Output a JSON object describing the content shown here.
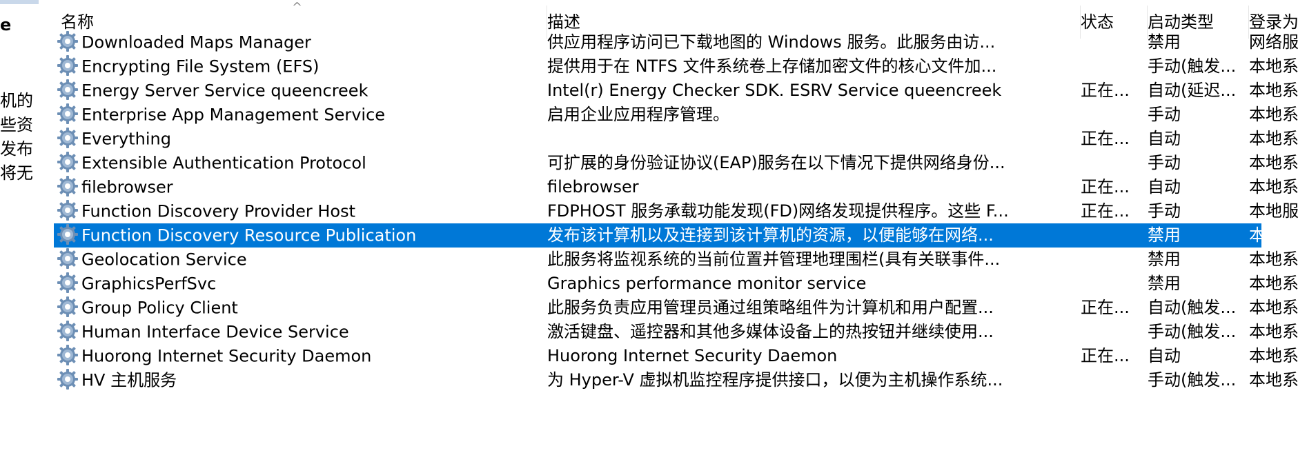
{
  "left_panel": {
    "heading": "e",
    "lines": [
      "机的",
      "些资",
      "发布",
      "将无"
    ]
  },
  "columns": {
    "name": "名称",
    "description": "描述",
    "status": "状态",
    "startup_type": "启动类型",
    "logon_as": "登录为",
    "sort_indicator": "^"
  },
  "rows": [
    {
      "name": "Downloaded Maps Manager",
      "description": "供应用程序访问已下载地图的 Windows 服务。此服务由访...",
      "status": "",
      "startup": "禁用",
      "logon": "网络服务"
    },
    {
      "name": "Encrypting File System (EFS)",
      "description": "提供用于在 NTFS 文件系统卷上存储加密文件的核心文件加...",
      "status": "",
      "startup": "手动(触发...",
      "logon": "本地系统"
    },
    {
      "name": "Energy Server Service queencreek",
      "description": "Intel(r) Energy Checker SDK. ESRV Service queencreek",
      "status": "正在...",
      "startup": "自动(延迟...",
      "logon": "本地系统"
    },
    {
      "name": "Enterprise App Management Service",
      "description": "启用企业应用程序管理。",
      "status": "",
      "startup": "手动",
      "logon": "本地系统"
    },
    {
      "name": "Everything",
      "description": "",
      "status": "正在...",
      "startup": "自动",
      "logon": "本地系统"
    },
    {
      "name": "Extensible Authentication Protocol",
      "description": "可扩展的身份验证协议(EAP)服务在以下情况下提供网络身份...",
      "status": "",
      "startup": "手动",
      "logon": "本地系统"
    },
    {
      "name": "filebrowser",
      "description": "filebrowser",
      "status": "正在...",
      "startup": "自动",
      "logon": "本地系统"
    },
    {
      "name": "Function Discovery Provider Host",
      "description": "FDPHOST 服务承载功能发现(FD)网络发现提供程序。这些 F...",
      "status": "正在...",
      "startup": "手动",
      "logon": "本地服务"
    },
    {
      "name": "Function Discovery Resource Publication",
      "description": "发布该计算机以及连接到该计算机的资源，以便能够在网络...",
      "status": "",
      "startup": "禁用",
      "logon": "本地服务",
      "selected": true
    },
    {
      "name": "Geolocation Service",
      "description": "此服务将监视系统的当前位置并管理地理围栏(具有关联事件...",
      "status": "",
      "startup": "禁用",
      "logon": "本地系统"
    },
    {
      "name": "GraphicsPerfSvc",
      "description": "Graphics performance monitor service",
      "status": "",
      "startup": "禁用",
      "logon": "本地系统"
    },
    {
      "name": "Group Policy Client",
      "description": "此服务负责应用管理员通过组策略组件为计算机和用户配置...",
      "status": "正在...",
      "startup": "自动(触发...",
      "logon": "本地系统"
    },
    {
      "name": "Human Interface Device Service",
      "description": "激活键盘、遥控器和其他多媒体设备上的热按钮并继续使用...",
      "status": "",
      "startup": "手动(触发...",
      "logon": "本地系统"
    },
    {
      "name": "Huorong Internet Security Daemon",
      "description": "Huorong Internet Security Daemon",
      "status": "正在...",
      "startup": "自动",
      "logon": "本地系统"
    },
    {
      "name": "HV 主机服务",
      "description": "为 Hyper-V 虚拟机监控程序提供接口，以便为主机操作系统...",
      "status": "",
      "startup": "手动(触发...",
      "logon": "本地系统"
    }
  ],
  "colors": {
    "selection": "#0078d7",
    "gear": "#5b7fa6"
  },
  "icons": {
    "row_icon": "service-gear-icon"
  }
}
